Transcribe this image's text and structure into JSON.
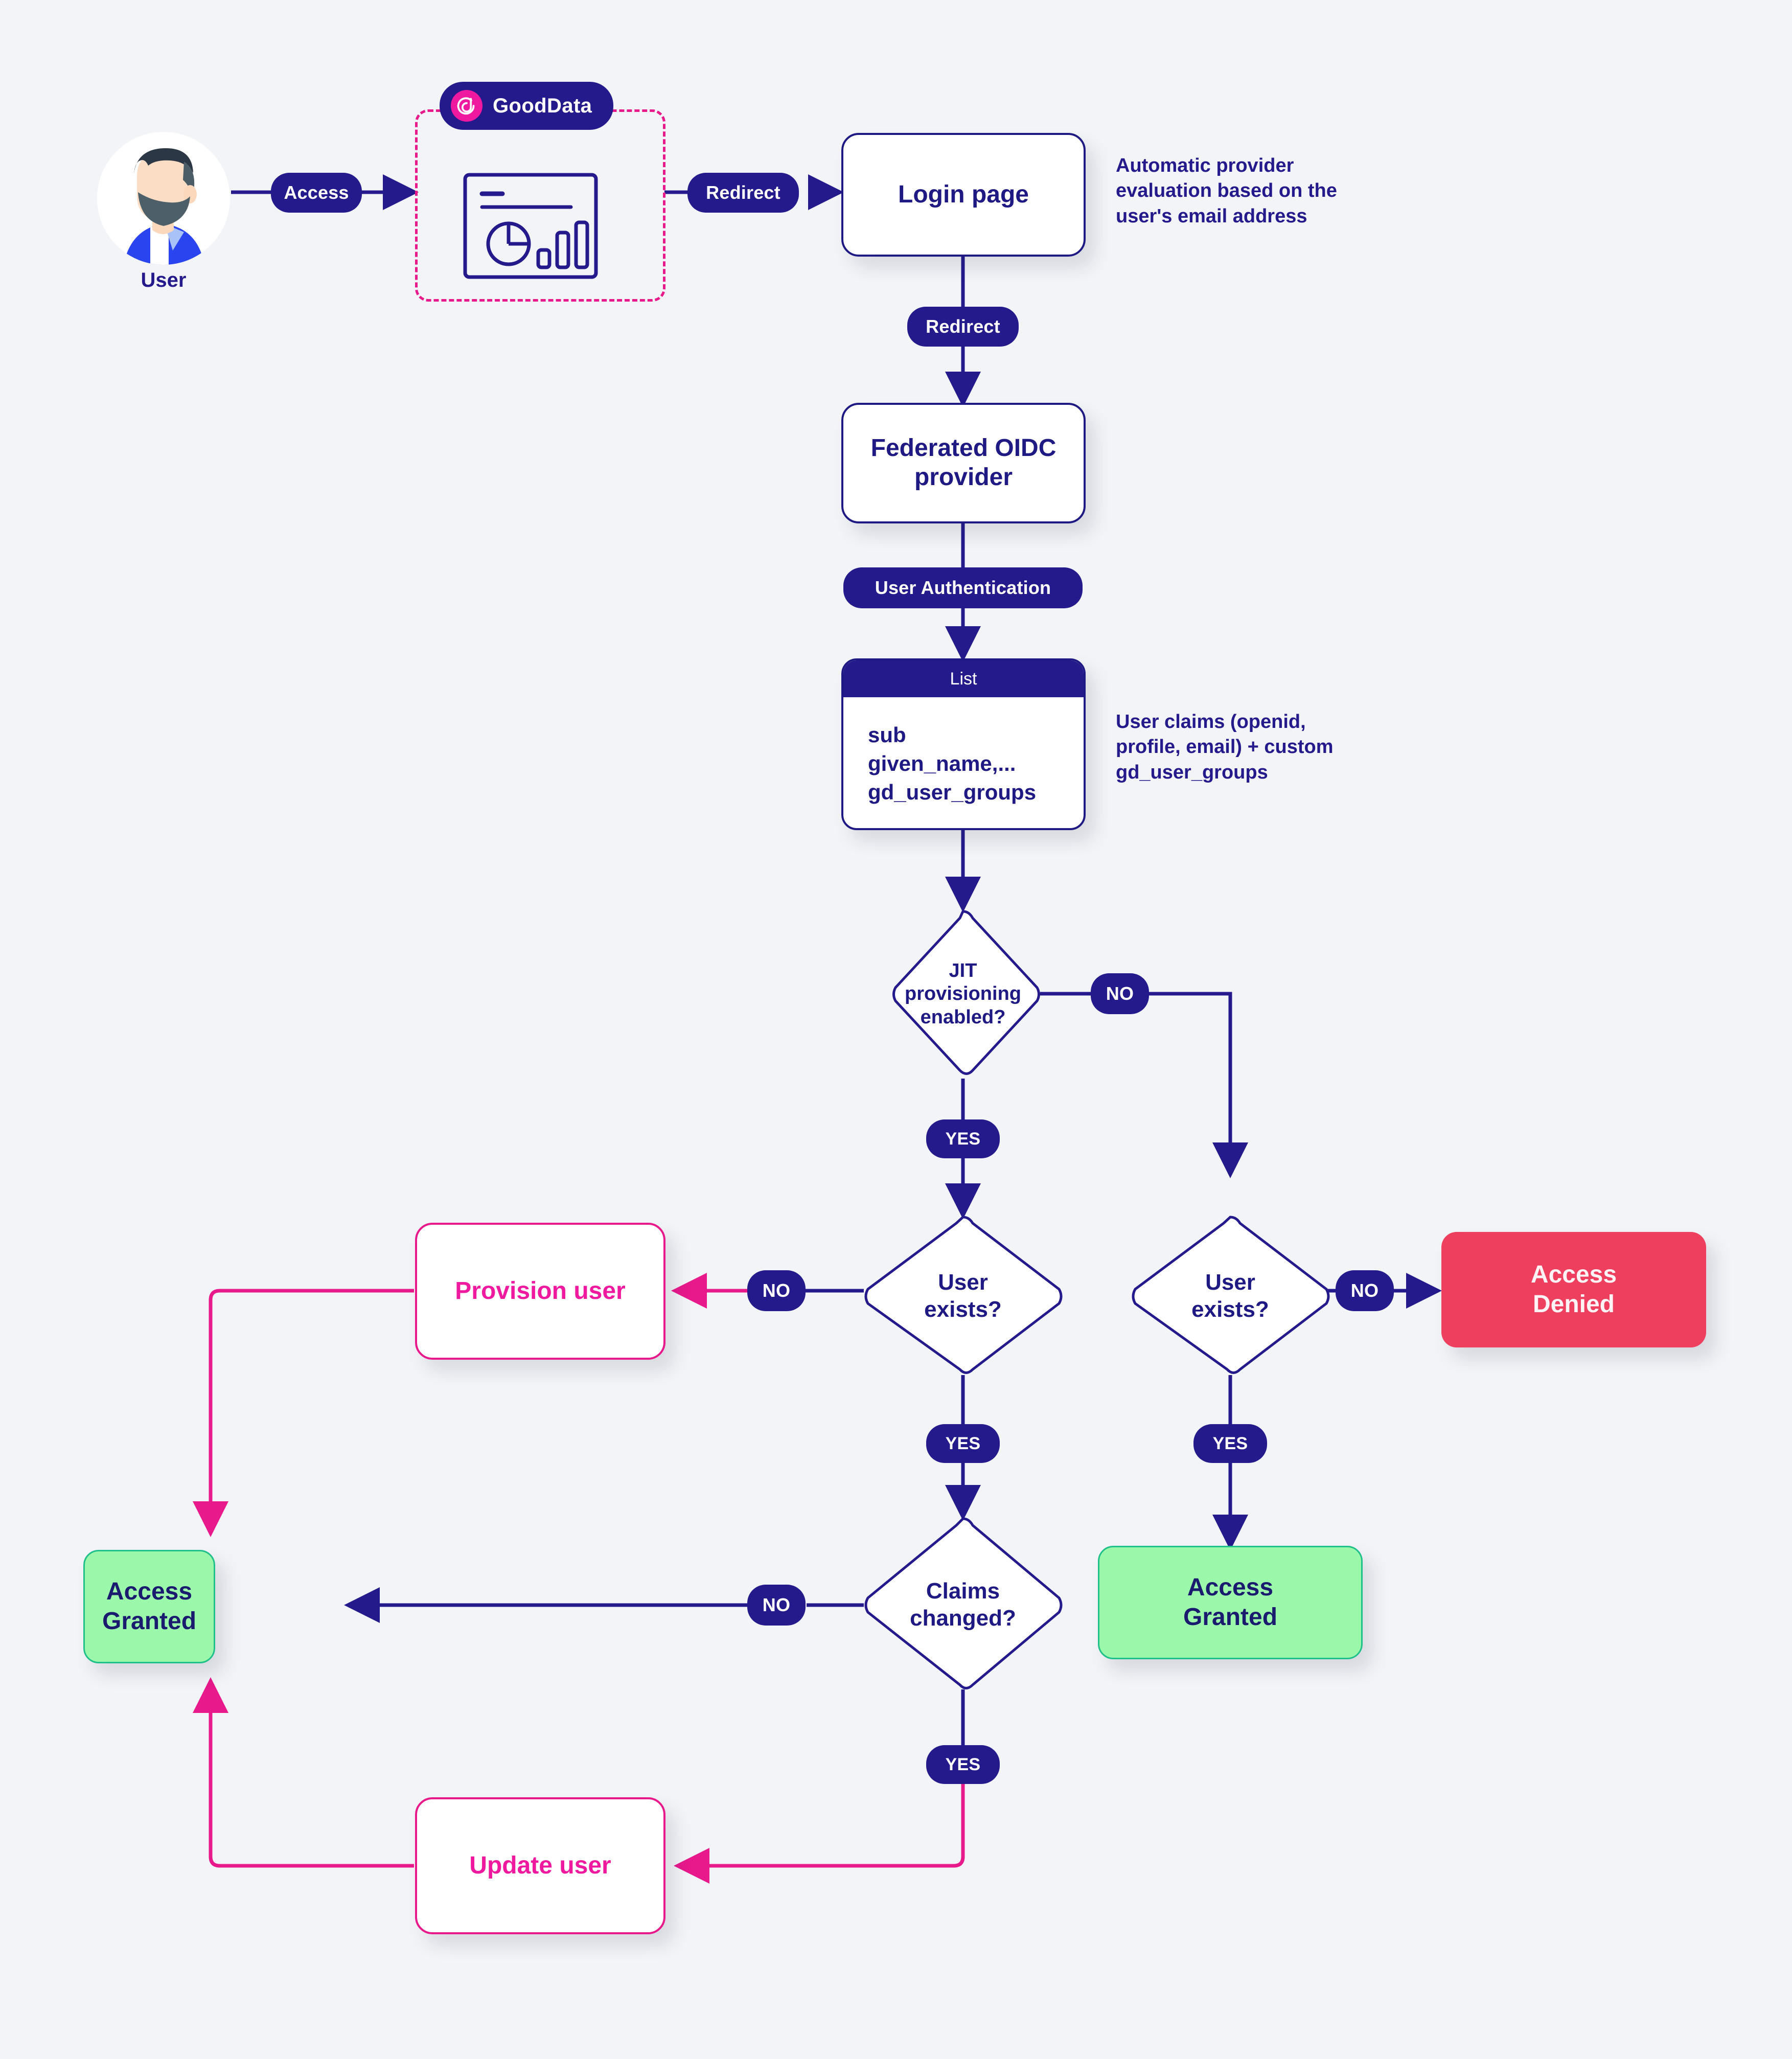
{
  "diagram": {
    "title": "GoodData SSO / JIT provisioning authentication flow",
    "colors": {
      "navy": "#241a8c",
      "navy_dark": "#1f1a83",
      "pink": "#e8198b",
      "pink_text": "#ef19a0",
      "green_fill": "#9bf7a9",
      "green_border": "#1fc08a",
      "red_fill": "#ef3f5f",
      "background": "#f2f4f7",
      "white": "#ffffff"
    }
  },
  "actor": {
    "label": "User",
    "icon": "user-avatar-icon"
  },
  "gooddata": {
    "badge_label": "GoodData",
    "logo_icon": "gooddata-logo-icon",
    "dashboard_icon": "dashboard-chart-icon"
  },
  "nodes": {
    "login_page": "Login page",
    "federated_oidc": "Federated OIDC\nprovider",
    "claims_list_header": "List",
    "claims_list_items": "sub\ngiven_name,...\ngd_user_groups",
    "jit_decision": "JIT\nprovisioning\nenabled?",
    "user_exists_left": "User\nexists?",
    "user_exists_right": "User\nexists?",
    "claims_changed": "Claims\nchanged?",
    "provision_user": "Provision user",
    "update_user": "Update user",
    "access_granted_left": "Access\nGranted",
    "access_granted_right": "Access\nGranted",
    "access_denied": "Access\nDenied"
  },
  "edge_labels": {
    "access": "Access",
    "redirect_1": "Redirect",
    "redirect_2": "Redirect",
    "user_authentication": "User Authentication",
    "jit_no": "NO",
    "jit_yes": "YES",
    "left_exists_no": "NO",
    "left_exists_yes": "YES",
    "right_exists_no": "NO",
    "right_exists_yes": "YES",
    "claims_no": "NO",
    "claims_yes": "YES"
  },
  "annotations": {
    "provider_evaluation": "Automatic provider\nevaluation based on the\nuser's email address",
    "user_claims": "User claims (openid,\nprofile, email) + custom\ngd_user_groups"
  }
}
